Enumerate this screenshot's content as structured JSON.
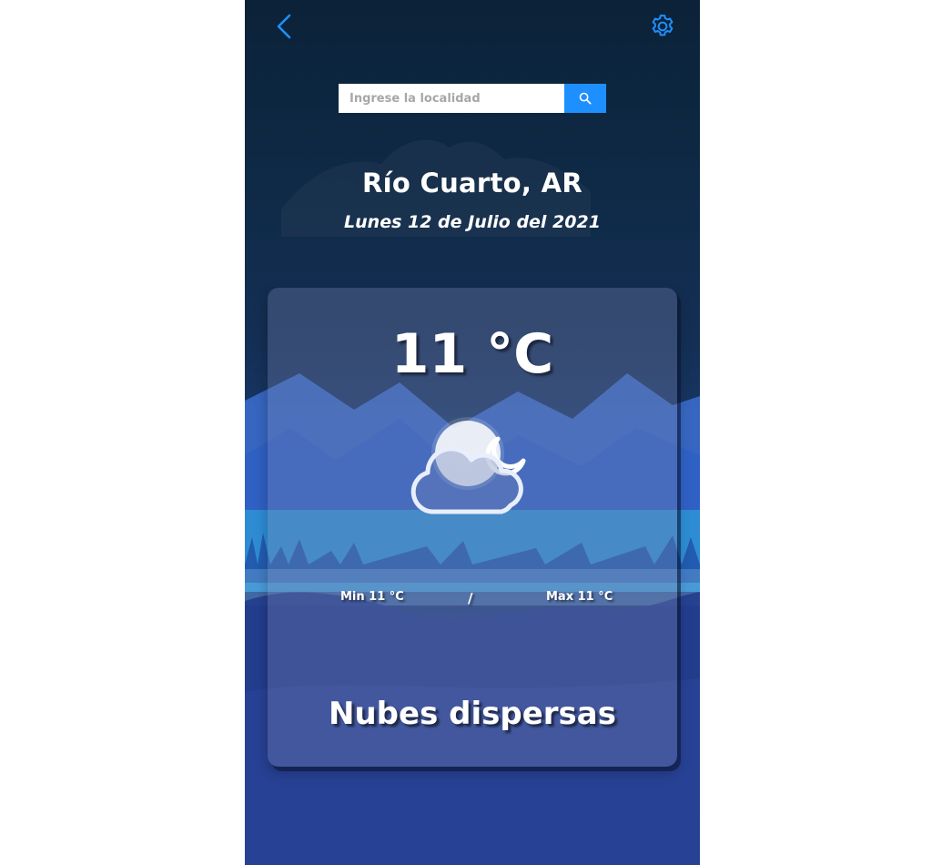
{
  "header": {
    "back_icon": "chevron-left-icon",
    "settings_icon": "gear-icon",
    "accent_color": "#1e8fff"
  },
  "search": {
    "placeholder": "Ingrese la localidad",
    "value": "",
    "button_icon": "search-icon"
  },
  "location": {
    "city": "Río Cuarto, AR",
    "date": "Lunes 12 de Julio del 2021"
  },
  "weather": {
    "temperature": "11 °C",
    "icon": "cloud-moon-icon",
    "min": "Min 11 °C",
    "separator": "/",
    "max": "Max 11 °C",
    "description": "Nubes dispersas"
  }
}
